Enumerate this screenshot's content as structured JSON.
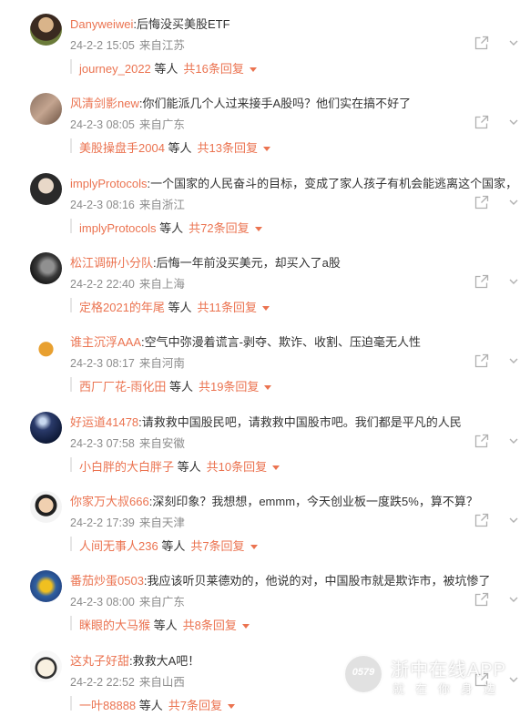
{
  "comments": [
    {
      "user": "Danyweiwei",
      "text": ":后悔没买美股ETF",
      "date": "24-2-2 15:05",
      "location": "来自江苏",
      "reply_user": "journey_2022",
      "reply_mid": " 等人",
      "reply_total": "共16条回复"
    },
    {
      "user": "风清剑影new",
      "text": ":你们能派几个人过来接手A股吗？他们实在搞不好了",
      "date": "24-2-3 08:05",
      "location": "来自广东",
      "reply_user": "美股操盘手2004",
      "reply_mid": " 等人",
      "reply_total": "共13条回复"
    },
    {
      "user": "implyProtocols",
      "text": ":一个国家的人民奋斗的目标，变成了家人孩子有机会能逃离这个国家，",
      "date": "24-2-3 08:16",
      "location": "来自浙江",
      "reply_user": "implyProtocols",
      "reply_mid": " 等人",
      "reply_total": "共72条回复"
    },
    {
      "user": "松江调研小分队",
      "text": ":后悔一年前没买美元，却买入了a股",
      "date": "24-2-2 22:40",
      "location": "来自上海",
      "reply_user": "定格2021的年尾",
      "reply_mid": " 等人",
      "reply_total": "共11条回复"
    },
    {
      "user": "谁主沉浮AAA",
      "text": ":空气中弥漫着谎言-剥夺、欺诈、收割、压迫毫无人性",
      "date": "24-2-3 08:17",
      "location": "来自河南",
      "reply_user": "西厂厂花-雨化田",
      "reply_mid": " 等人",
      "reply_total": "共19条回复"
    },
    {
      "user": "好运道41478",
      "text": ":请救救中国股民吧，请救救中国股市吧。我们都是平凡的人民",
      "date": "24-2-3 07:58",
      "location": "来自安徽",
      "reply_user": "小白胖的大白胖子",
      "reply_mid": " 等人",
      "reply_total": "共10条回复"
    },
    {
      "user": "你家万大叔666",
      "text": ":深刻印象？我想想，emmm，今天创业板一度跌5%，算不算？",
      "date": "24-2-2 17:39",
      "location": "来自天津",
      "reply_user": "人间无事人236",
      "reply_mid": " 等人",
      "reply_total": "共7条回复"
    },
    {
      "user": "番茄炒蛋0503",
      "text": ":我应该听贝莱德劝的，他说的对，中国股市就是欺诈市，被坑惨了",
      "date": "24-2-3 08:00",
      "location": "来自广东",
      "reply_user": "眯眼的大马猴",
      "reply_mid": " 等人",
      "reply_total": "共8条回复"
    },
    {
      "user": "这丸子好甜",
      "text": ":救救大A吧！",
      "date": "24-2-2 22:52",
      "location": "来自山西",
      "reply_user": "一叶88888",
      "reply_mid": " 等人",
      "reply_total": "共7条回复"
    }
  ],
  "watermark": {
    "title": "浙中在线APP",
    "slogan": "就在你身边",
    "logo_text": "0579"
  },
  "colors": {
    "username": "#eb7350",
    "text": "#333333",
    "meta": "#8c8c8c",
    "icon": "#b0b0b0"
  },
  "icons": {
    "share": "share-icon",
    "more": "more-icon"
  }
}
